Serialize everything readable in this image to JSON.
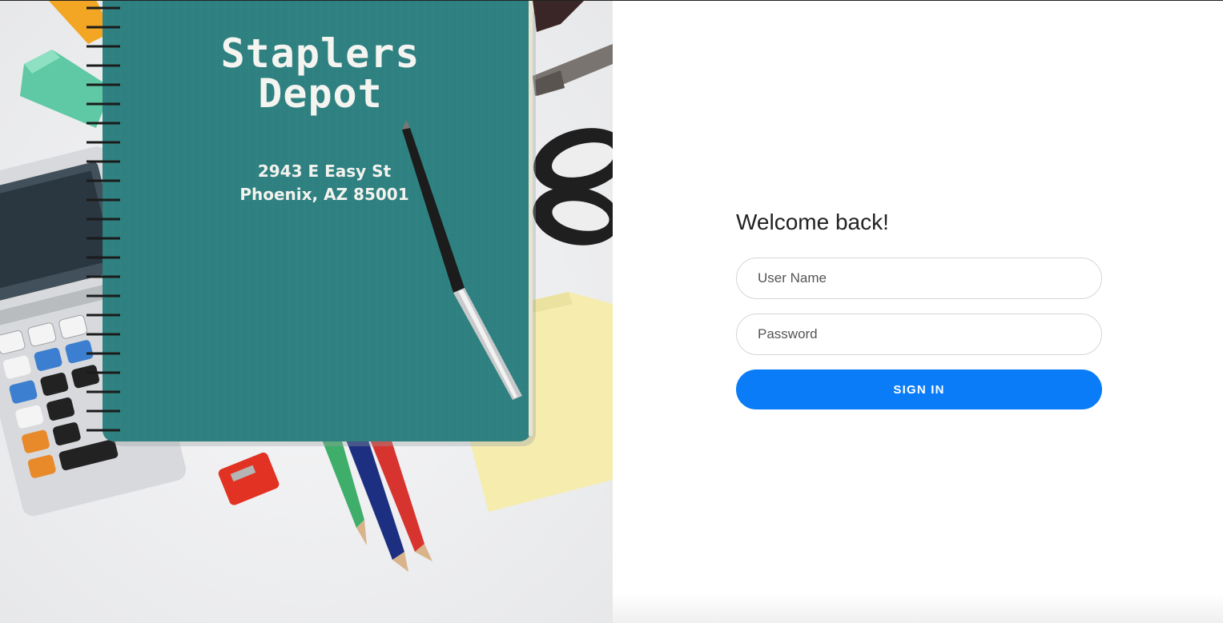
{
  "hero": {
    "brand_line1": "Staplers",
    "brand_line2": "Depot",
    "address_line1": "2943 E Easy St",
    "address_line2": "Phoenix, AZ 85001"
  },
  "login": {
    "heading": "Welcome back!",
    "username_placeholder": "User Name",
    "password_placeholder": "Password",
    "signin_label": "SIGN IN"
  },
  "colors": {
    "accent": "#0a7cf8",
    "notebook": "#2f8080"
  },
  "icons": [
    "calculator",
    "notebook",
    "pen",
    "scissors",
    "pencil-sharpener",
    "colored-pencils",
    "sticky-note",
    "highlighter"
  ]
}
